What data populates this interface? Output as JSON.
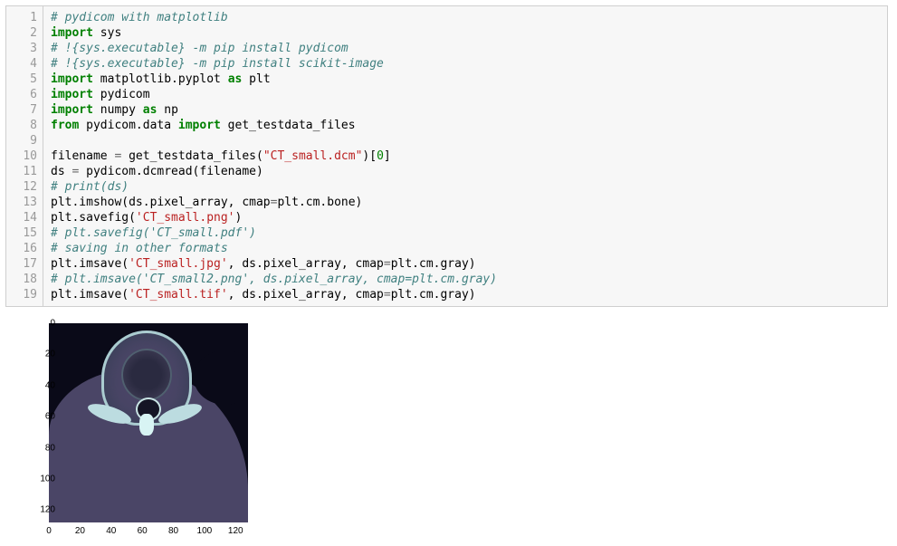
{
  "code": {
    "line_numbers": [
      "1",
      "2",
      "3",
      "4",
      "5",
      "6",
      "7",
      "8",
      "9",
      "10",
      "11",
      "12",
      "13",
      "14",
      "15",
      "16",
      "17",
      "18",
      "19"
    ],
    "lines": [
      [
        [
          "tok-cm",
          "# pydicom with matplotlib"
        ]
      ],
      [
        [
          "tok-kw",
          "import"
        ],
        [
          "",
          " sys"
        ]
      ],
      [
        [
          "tok-cm",
          "# !{sys.executable} -m pip install pydicom"
        ]
      ],
      [
        [
          "tok-cm",
          "# !{sys.executable} -m pip install scikit-image"
        ]
      ],
      [
        [
          "tok-kw",
          "import"
        ],
        [
          "",
          " matplotlib.pyplot "
        ],
        [
          "tok-kw",
          "as"
        ],
        [
          "",
          " plt"
        ]
      ],
      [
        [
          "tok-kw",
          "import"
        ],
        [
          "",
          " pydicom"
        ]
      ],
      [
        [
          "tok-kw",
          "import"
        ],
        [
          "",
          " numpy "
        ],
        [
          "tok-kw",
          "as"
        ],
        [
          "",
          " np"
        ]
      ],
      [
        [
          "tok-kw",
          "from"
        ],
        [
          "",
          " pydicom.data "
        ],
        [
          "tok-kw",
          "import"
        ],
        [
          "",
          " get_testdata_files"
        ]
      ],
      [
        [
          "",
          ""
        ]
      ],
      [
        [
          "",
          "filename "
        ],
        [
          "tok-op",
          "="
        ],
        [
          "",
          " get_testdata_files("
        ],
        [
          "tok-str",
          "\"CT_small.dcm\""
        ],
        [
          "",
          ")["
        ],
        [
          "tok-num",
          "0"
        ],
        [
          "",
          "]"
        ]
      ],
      [
        [
          "",
          "ds "
        ],
        [
          "tok-op",
          "="
        ],
        [
          "",
          " pydicom.dcmread(filename)"
        ]
      ],
      [
        [
          "tok-cm",
          "# print(ds)"
        ]
      ],
      [
        [
          "",
          "plt.imshow(ds.pixel_array, cmap"
        ],
        [
          "tok-op",
          "="
        ],
        [
          "",
          "plt.cm.bone)"
        ]
      ],
      [
        [
          "",
          "plt.savefig("
        ],
        [
          "tok-str",
          "'CT_small.png'"
        ],
        [
          "",
          ")"
        ]
      ],
      [
        [
          "tok-cm",
          "# plt.savefig('CT_small.pdf')"
        ]
      ],
      [
        [
          "tok-cm",
          "# saving in other formats"
        ]
      ],
      [
        [
          "",
          "plt.imsave("
        ],
        [
          "tok-str",
          "'CT_small.jpg'"
        ],
        [
          "",
          ", ds.pixel_array, cmap"
        ],
        [
          "tok-op",
          "="
        ],
        [
          "",
          "plt.cm.gray)"
        ]
      ],
      [
        [
          "tok-cm",
          "# plt.imsave('CT_small2.png', ds.pixel_array, cmap=plt.cm.gray)"
        ]
      ],
      [
        [
          "",
          "plt.imsave("
        ],
        [
          "tok-str",
          "'CT_small.tif'"
        ],
        [
          "",
          ", ds.pixel_array, cmap"
        ],
        [
          "tok-op",
          "="
        ],
        [
          "",
          "plt.cm.gray)"
        ]
      ]
    ]
  },
  "chart_data": {
    "type": "image",
    "title": "",
    "xlabel": "",
    "ylabel": "",
    "xlim": [
      0,
      128
    ],
    "ylim": [
      128,
      0
    ],
    "xticks": [
      0,
      20,
      40,
      60,
      80,
      100,
      120
    ],
    "yticks": [
      0,
      20,
      40,
      60,
      80,
      100,
      120
    ],
    "cmap": "bone",
    "description": "CT_small.dcm pixel array displayed with bone colormap; visible vertebra cross-section"
  }
}
